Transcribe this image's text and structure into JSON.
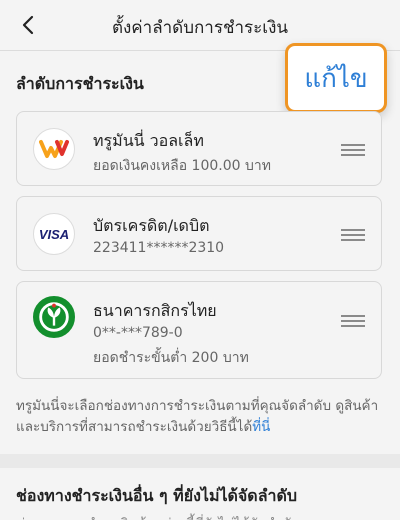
{
  "header": {
    "title": "ตั้งค่าลำดับการชำระเงิน"
  },
  "priority_section": {
    "title": "ลำดับการชำระเงิน",
    "edit_label": "แก้ไข"
  },
  "payment_methods": [
    {
      "icon": "truemoney-wallet-icon",
      "name": "ทรูมันนี่ วอลเล็ท",
      "sub1": "ยอดเงินคงเหลือ 100.00 บาท"
    },
    {
      "icon": "visa-icon",
      "name": "บัตรเครดิต/เดบิต",
      "sub1": "223411******2310"
    },
    {
      "icon": "kasikornbank-icon",
      "name": "ธนาคารกสิกรไทย",
      "sub1": "0**-***789-0",
      "sub2": "ยอดชำระขั้นต่ำ 200 บาท"
    }
  ],
  "note": {
    "text": "ทรูมันนี่จะเลือกช่องทางการชำระเงินตามที่คุณจัดลำดับ ดูสินค้าและบริการที่สามารถชำระเงินด้วยวิธีนี้ได้",
    "link": "ที่นี่"
  },
  "other_section": {
    "title": "ช่องทางชำระเงินอื่น ๆ ที่ยังไม่ได้จัดลำดับ",
    "peek": "ช่องทางการชำระเงินด้านล่างนี้ที่ยังไม่ได้จัดลำดับ"
  },
  "colors": {
    "accent_blue": "#2e7fd6",
    "highlight_orange": "#ef9524",
    "visa_blue": "#1a1f71",
    "kbank_green": "#138f2d",
    "truemoney_red": "#e0332d",
    "truemoney_orange": "#f7a21b"
  }
}
